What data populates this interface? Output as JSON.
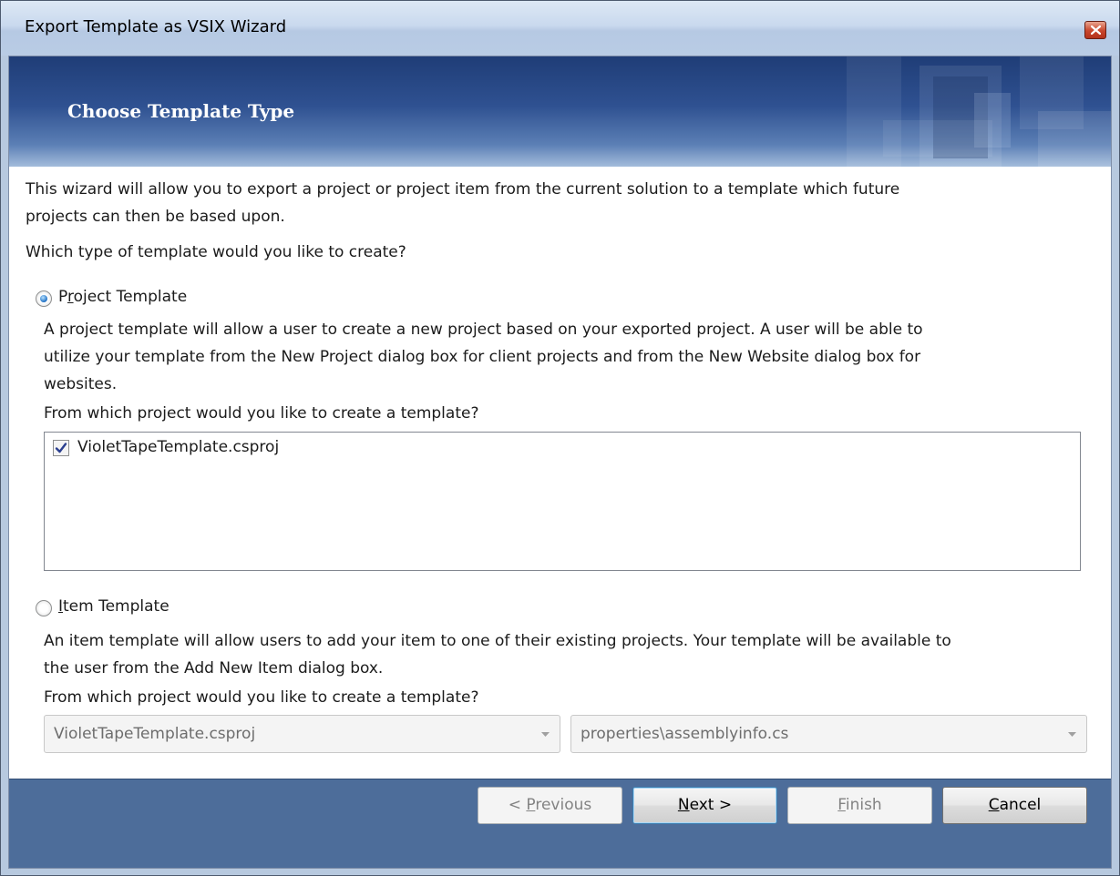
{
  "window": {
    "title": "Export Template as VSIX Wizard"
  },
  "banner": {
    "title": "Choose Template Type"
  },
  "intro": {
    "line1": "This wizard will allow you to export a project or project item from the current solution to a template which future",
    "line2": "projects can then be based upon.",
    "question": "Which type of template would you like to create?"
  },
  "project_template": {
    "label_before": "P",
    "label_mnemonic": "r",
    "label_after": "oject Template",
    "selected": true,
    "desc_line1": "A project template will allow a user to create a new project based on your exported project. A user will be able to",
    "desc_line2": "utilize your template from the New Project dialog box for client projects and from the New Website dialog box for",
    "desc_line3": "websites.",
    "source_label": "From which project would you like to create a template?",
    "projects": [
      {
        "name": "VioletTapeTemplate.csproj",
        "checked": true
      }
    ]
  },
  "item_template": {
    "label_mnemonic": "I",
    "label_after": "tem Template",
    "selected": false,
    "desc_line1": "An item template will allow users to add your item to one of their existing projects. Your template will be available to",
    "desc_line2": "the user from the Add New Item dialog box.",
    "source_label": "From which project would you like to create a template?",
    "project_select": "VioletTapeTemplate.csproj",
    "item_select": "properties\\assemblyinfo.cs"
  },
  "buttons": {
    "previous_prefix": "< ",
    "previous_mnemonic": "P",
    "previous_rest": "revious",
    "next_mnemonic": "N",
    "next_rest": "ext >",
    "finish_mnemonic": "F",
    "finish_rest": "inish",
    "cancel_mnemonic": "C",
    "cancel_rest": "ancel"
  },
  "colors": {
    "banner_dark": "#1f3d77",
    "footer": "#4d6d9a",
    "radio_accent": "#1e6fc4"
  }
}
